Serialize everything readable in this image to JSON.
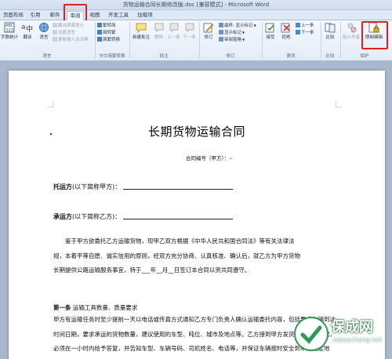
{
  "window": {
    "title": "货物运输合同长期修改版.doc [兼容模式] - Microsoft Word"
  },
  "tabs": [
    {
      "label": "页面布局"
    },
    {
      "label": "引用"
    },
    {
      "label": "邮件"
    },
    {
      "label": "审阅",
      "active": true
    },
    {
      "label": "视图"
    },
    {
      "label": "开发工具"
    },
    {
      "label": "加载项"
    }
  ],
  "ribbon": {
    "proofing": {
      "word_count": "字数统计",
      "translate": "翻译",
      "language": "语言",
      "translate_screentip": "翻译屏幕提示",
      "set_language": "设置语言",
      "update_ime": "更新输入法词典",
      "label": "语言"
    },
    "chinese": {
      "simp": "繁转简",
      "trad": "简转繁",
      "convert": "简繁转换",
      "label": "中文简繁转换"
    },
    "comments": {
      "new": "新建批注",
      "delete": "删除",
      "prev": "上一条",
      "next": "下一条",
      "label": "批注"
    },
    "tracking": {
      "track": "修订",
      "final_show": "最终: 显示标记",
      "show_markup": "显示标记",
      "review_pane": "审阅窗格",
      "label": "修订"
    },
    "changes": {
      "accept": "接受",
      "reject": "拒绝",
      "prev": "上一条",
      "next": "下一条",
      "label": "更改"
    },
    "compare": {
      "compare": "比较",
      "label": "比较"
    },
    "protect": {
      "block_authors": "阻止作者",
      "restrict_editing": "限制编辑",
      "label": "保护"
    }
  },
  "document": {
    "title": "长期货物运输合同",
    "contract_no": "合同编号（甲方）：",
    "shipper_label": "托运方",
    "shipper_rest": "(以下简称甲方)：",
    "carrier_label": "承运方",
    "carrier_rest": "(以下简称乙方)：",
    "para1": "鉴于甲方欲委托乙方运输货物，现甲乙双方根据《中华人民共和国合同法》等有关法律法规，本着平等自愿、诚实信用的原则，经双方充分协商、认真核准、确认后，就乙方为甲方货物长期提供公路运输服务事宜，特于___年__月__日签订本合同以资共同遵守。",
    "article1_label": "第一条",
    "article1_title": "运输工具数量、质量要求",
    "para2": "甲方有运输任务时至少提前一天以电话或传真方式通知乙方专门负责人确认运输委托内容，包括要求车辆到达时间日期，要求承运的货物数量，建议使用的车型、吨位、城市及地点等。乙方接到甲方发货任务通知时起，必须在一小时内给予答复，并告知车型、车辆号码、司机姓名、电话等，并保证车辆按时安全到甲方指定地点。"
  },
  "watermark": {
    "text": "保成网",
    "url": "zsbaocheng.net"
  }
}
